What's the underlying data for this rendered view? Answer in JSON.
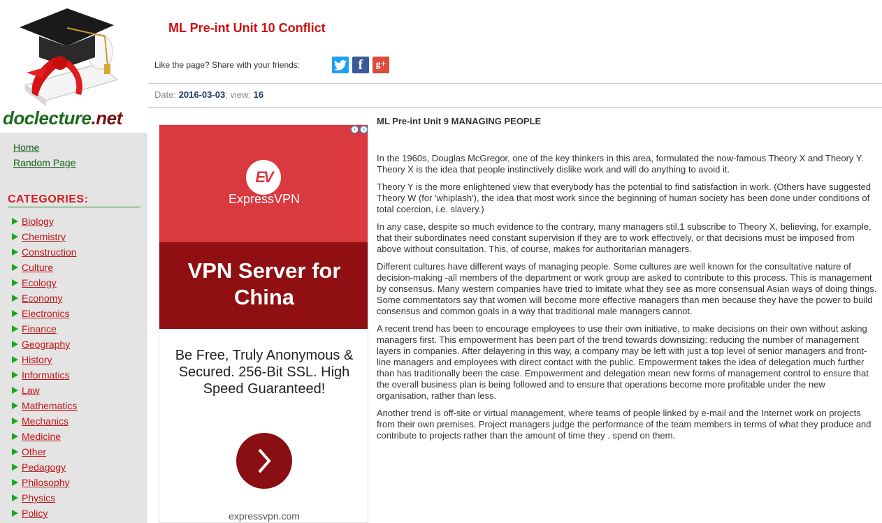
{
  "site": {
    "logo_part1": "doclecture",
    "logo_part2": ".net"
  },
  "nav": {
    "home": "Home",
    "random": "Random Page"
  },
  "categories": {
    "title": "CATEGORIES:",
    "items": [
      "Biology",
      "Chemistry",
      "Construction",
      "Culture",
      "Ecology",
      "Economy",
      "Electronics",
      "Finance",
      "Geography",
      "History",
      "Informatics",
      "Law",
      "Mathematics",
      "Mechanics",
      "Medicine",
      "Other",
      "Pedagogy",
      "Philosophy",
      "Physics",
      "Policy"
    ]
  },
  "page": {
    "title": "ML Pre-int Unit 10 Conflict",
    "share_text": "Like the page? Share with your friends:",
    "date_label": "Date: ",
    "date": "2016-03-03",
    "view_label": "; view: ",
    "views": "16"
  },
  "ad": {
    "brand": "ExpressVPN",
    "headline": "VPN Server for China",
    "body": "Be Free, Truly Anonymous & Secured. 256-Bit SSL. High Speed Guaranteed!",
    "url": "expressvpn.com"
  },
  "article": {
    "title": "ML Pre-int Unit 9 MANAGING PEOPLE",
    "paragraphs": [
      "In the 1960s, Douglas McGregor, one of the key thinkers in this area, formulated the now-famous Theory X and Theory Y. Theory X is the idea that people instinctively dislike work and will do anything to avoid it.",
      "Theory Y is the more enlightened view that everybody has the potential to find satisfaction in work. (Others have suggested Theory W (for 'whiplash'), the idea that most work since the beginning of human society has been done under conditions of total coercion, i.e. slavery.)",
      "In any case, despite so much evidence to the contrary, many managers stil.1 subscribe to Theory X, believing, for example, that their subordinates need constant supervision if they are to work effectively, or that decisions must be imposed from above without consultation. This, of course, makes for authoritarian managers.",
      "Different cultures have different ways of managing people. Some cultures are well known for the consultative nature of decision-making -all members of the department or work group are asked to contribute to this process. This is management by consensus. Many western companies have tried to imitate what they see as more consensual Asian ways of doing things. Some commentators say that women will become more effective managers than men because they have the power to build consensus and common goals in a way that traditional male managers cannot.",
      "A recent trend has been to encourage employees to use their own initiative, to make decisions on their own without asking managers first. This empowerment has been part of the trend towards downsizing: reducing the number of management layers in companies. After delayering in this way, a company may be left with just a top level of senior managers and front-line managers and employees with direct contact with the public. Empowerment takes the idea of delegation much further than has traditionally been the case. Empowerment and delegation mean new forms of management control to ensure that the overall business plan is being followed and to ensure that operations become more profitable under the new organisation, rather than less.",
      "Another trend is off-site or virtual management, where teams of people linked by e-mail and the Internet work on projects from their own premises. Project managers judge the performance of the team members in terms of what they produce and contribute to projects rather than the amount of time they . spend on them."
    ]
  },
  "icons": {
    "graduation": "graduation-cap-icon",
    "twitter": "twitter-icon",
    "facebook": "facebook-icon",
    "gplus": "google-plus-icon",
    "bullet": "triangle-bullet-icon",
    "chevron": "chevron-right-icon"
  },
  "colors": {
    "title_red": "#d10f0f",
    "nav_green": "#155e14",
    "link_red": "#c01414",
    "bullet_green": "#1aa61a",
    "sidebar_bg": "#e4e4e4",
    "ad_red": "#da3940",
    "ad_dark": "#8f0f12"
  }
}
